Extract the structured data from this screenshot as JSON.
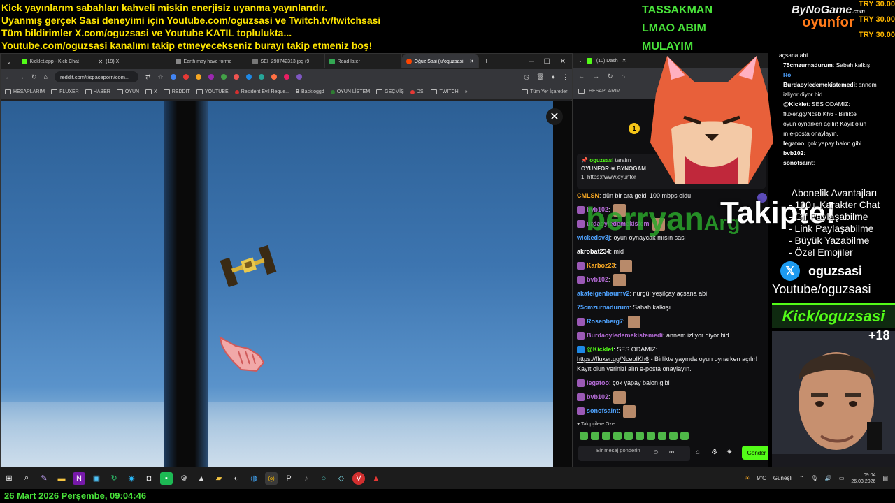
{
  "overlay": {
    "ticker_lines": [
      "Kick yayınlarım sabahları kahveli miskin enerjisiz uyanma yayınlarıdır.",
      "Uyanmış gerçek Sasi deneyimi için Youtube.com/oguzsasi ve Twitch.tv/twitchsasi",
      "Tüm bildirimler X.com/oguzsasi ve Youtube KATIL topluluktа...",
      "Youtube.com/oguzsasi kanalımı takip etmeyecekseniz burayı takip etmeniz boş!"
    ],
    "green_words": [
      "TASSAKMAN",
      "LMAO ABIM",
      "MULAYIM"
    ],
    "sponsor_top": "ByNoGame",
    "sponsor_com": ".com",
    "sponsor_bottom": "oyunfor",
    "try_values": [
      "TRY 30.00",
      "TRY 30.00",
      "TRY 30.00"
    ],
    "big_name": "berryan",
    "big_name_tail": "Arg",
    "takipte": "Takipte!",
    "perks_title": "Abonelik Avantajları",
    "perks": [
      "- 100+ Karakter Chat",
      "- Gif Paylaşabilme",
      "- Link Paylaşabilme",
      "- Büyük Yazabilme",
      "- Özel Emojiler"
    ],
    "x_handle": "oguzsasi",
    "youtube": "Youtube/oguzsasi",
    "kick": "Kick/oguzsasi",
    "age": "+18",
    "date_text": "26 Mart 2026 Perşembe, 09:04:46"
  },
  "right_chat": [
    {
      "user": "",
      "text": "açsana abi"
    },
    {
      "user": "75cmzurnadurum",
      "text": ": Sabah kalkışı"
    },
    {
      "user": "Ro",
      "text": ""
    },
    {
      "user": "Burdaoyledemekistemedi",
      "text": ": annem"
    },
    {
      "user": "",
      "text": "izliyor diyor bid"
    },
    {
      "user": "@Kicklet",
      "text": ": SES ODAMIZ:"
    },
    {
      "user": "",
      "text": "fluxer.gg/NcebIKh6 - Birlikte"
    },
    {
      "user": "",
      "text": "oyun oynarken açılır! Kayıt olun"
    },
    {
      "user": "",
      "text": "ın e-posta onaylayın."
    },
    {
      "user": "legatoo",
      "text": ": çok yapay balon gibi"
    },
    {
      "user": "bvb102",
      "text": ":"
    },
    {
      "user": "sonofsaint",
      "text": ":"
    }
  ],
  "browser": {
    "tabs": [
      {
        "label": "Kicklet.app - Kick Chat",
        "color": "#53fc18"
      },
      {
        "label": "(19) X",
        "color": "#ffffff"
      },
      {
        "label": "Earth may have forme",
        "color": "#888888"
      },
      {
        "label": "SEI_290742313.jpg (9",
        "color": "#777777"
      },
      {
        "label": "Read later",
        "color": "#34a853"
      },
      {
        "label": "Oğuz Sasi (u/oguzsasi",
        "color": "#ff4500"
      }
    ],
    "url": "reddit.com/r/spaceporn/com...",
    "bookmarks": [
      "HESAPLARIM",
      "FLUXER",
      "HABER",
      "OYUN",
      "X",
      "REDDIT",
      "YOUTUBE",
      "Resident Evil Reque...",
      "Backloggd",
      "OYUN LİSTEM",
      "GEÇMİŞ",
      "DSİ",
      "TWITCH"
    ],
    "all_bookmarks": "Tüm Yer İşaretleri"
  },
  "chat_browser": {
    "tab_label": "(10) Dash",
    "bookmark": "HESAPLARIM",
    "pinned_user": "oguzsasi",
    "pinned_suffix": "tarafın",
    "pinned_line1": "OYUNFOR ✷ BYNOGAM",
    "pinned_line2": "1: https://www.oyunfor",
    "coin": "1",
    "messages": [
      {
        "user": "CMLSN",
        "color": "#f5a623",
        "text": ": dün bir ara geldi 100 mbps oldu",
        "emote": false
      },
      {
        "user": "bvb102",
        "color": "#b46bd6",
        "text": ":",
        "emote": true
      },
      {
        "user": "urdaoyledemekistem",
        "color": "#b46bd6",
        "text": "",
        "emote": true
      },
      {
        "user": "wickedsv3j",
        "color": "#4fa3ff",
        "text": ": oyun oynaycak mısın sasi",
        "emote": false
      },
      {
        "user": "akrobat234",
        "color": "#ffffff",
        "text": ": mid",
        "emote": false
      },
      {
        "user": "Karboz23",
        "color": "#f5a623",
        "text": ":",
        "emote": true
      },
      {
        "user": "bvb102",
        "color": "#b46bd6",
        "text": ":",
        "emote": true
      },
      {
        "user": "akafeigenbaumv2",
        "color": "#4fa3ff",
        "text": ": nurgül yeşilçay açsana abi",
        "emote": false
      },
      {
        "user": "75cmzurnadurum",
        "color": "#4fa3ff",
        "text": ": Sabah kalkışı",
        "emote": false
      },
      {
        "user": "Rosenberg7",
        "color": "#4fa3ff",
        "text": ":",
        "emote": true
      },
      {
        "user": "Burdaoyledemekistemedi",
        "color": "#b46bd6",
        "text": ": annem izliyor diyor bid",
        "emote": false
      }
    ],
    "kicklet_user": "@Kicklet",
    "kicklet_text": ": SES ODAMIZ:",
    "kicklet_link": "https://fluxer.gg/NcebIKh6",
    "kicklet_rest": " - Birlikte yayında oyun oynarken açılır! Kayıt olun yerinizi alın e-posta onaylayın.",
    "messages2": [
      {
        "user": "legatoo",
        "color": "#b46bd6",
        "text": ": çok yapay balon gibi",
        "emote": false
      },
      {
        "user": "bvb102",
        "color": "#b46bd6",
        "text": ":",
        "emote": true
      },
      {
        "user": "sonofsaint",
        "color": "#4fa3ff",
        "text": ":",
        "emote": true
      }
    ],
    "followers_only": "Takipçilere Özel",
    "input_placeholder": "Bir mesaj gönderin",
    "send": "Gönder"
  },
  "taskbar": {
    "weather": "9°C",
    "weather_label": "Güneşli",
    "time": "09:04",
    "date": "26.03.2026"
  }
}
